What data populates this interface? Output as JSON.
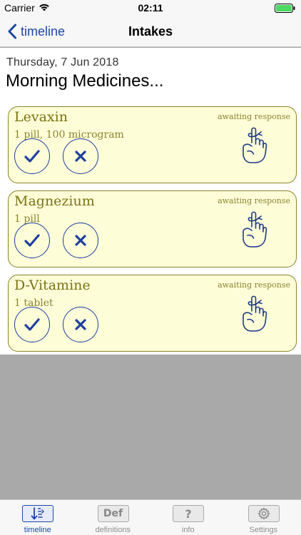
{
  "status_bar": {
    "carrier": "Carrier",
    "time": "02:11"
  },
  "nav": {
    "back_label": "timeline",
    "title": "Intakes"
  },
  "content": {
    "date": "Thursday, 7 Jun 2018",
    "section_title": "Morning Medicines...",
    "intakes": [
      {
        "name": "Levaxin",
        "dose": "1 pill, 100 microgram",
        "status": "awaiting response"
      },
      {
        "name": "Magnezium",
        "dose": "1 pill",
        "status": "awaiting response"
      },
      {
        "name": "D-Vitamine",
        "dose": "1 tablet",
        "status": "awaiting response"
      }
    ]
  },
  "tabs": [
    {
      "label": "timeline",
      "icon": "timeline-icon",
      "active": true
    },
    {
      "label": "definitions",
      "icon_text": "Def",
      "icon": "definitions-icon",
      "active": false
    },
    {
      "label": "info",
      "icon_text": "?",
      "icon": "info-icon",
      "active": false
    },
    {
      "label": "Settings",
      "icon": "gear-icon",
      "active": false
    }
  ],
  "colors": {
    "accent": "#1f47a8",
    "card_fill": "#fdfdd8",
    "card_border": "#8b8528",
    "card_text": "#7a7314",
    "battery": "#4cd964"
  }
}
